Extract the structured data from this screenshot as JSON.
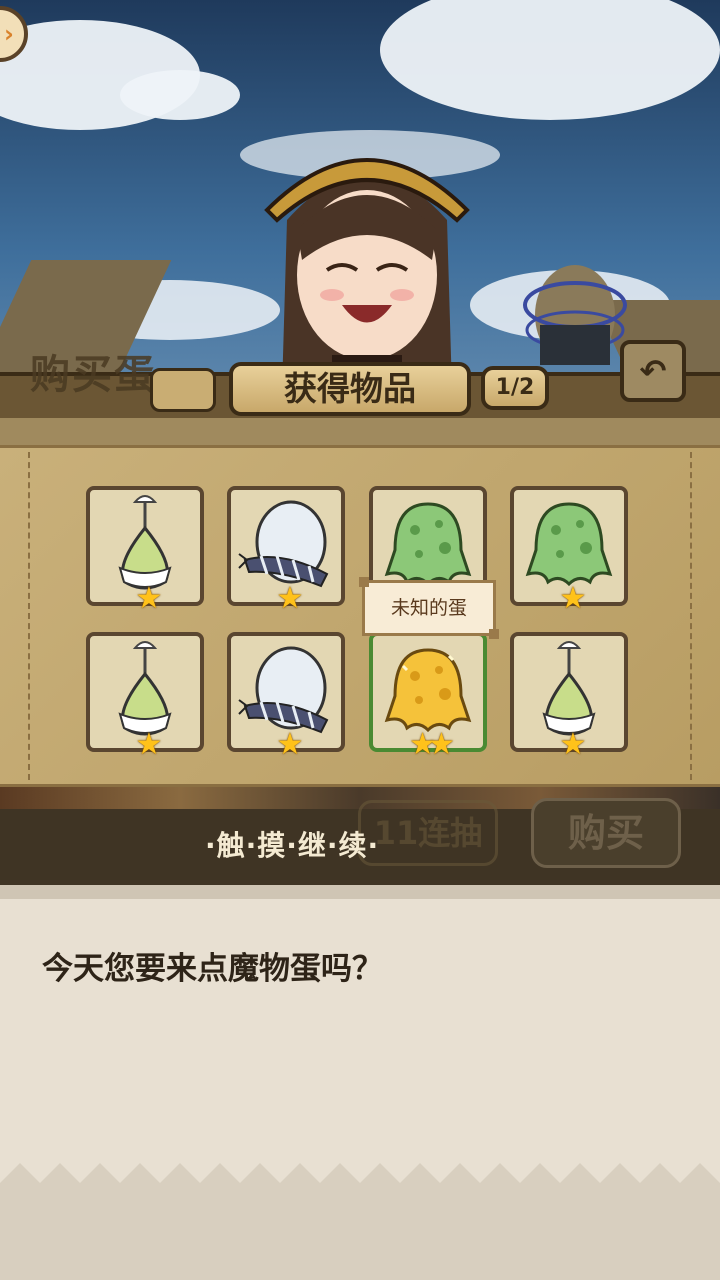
{
  "header": {
    "bg_title": "购买蛋",
    "title": "获得物品",
    "page_indicator": "1/2"
  },
  "grid": {
    "items": [
      {
        "name": "white-sprout-egg",
        "stars": "★"
      },
      {
        "name": "striped-feather-egg",
        "stars": "★"
      },
      {
        "name": "green-slime-egg",
        "stars": "★"
      },
      {
        "name": "green-slime-egg",
        "stars": "★"
      },
      {
        "name": "white-sprout-egg",
        "stars": "★"
      },
      {
        "name": "striped-feather-egg",
        "stars": "★"
      },
      {
        "name": "gold-slime-egg",
        "stars": "★★"
      },
      {
        "name": "white-sprout-egg",
        "stars": "★"
      }
    ],
    "tooltip": "未知的蛋"
  },
  "actions": {
    "ghost_tab": "11连抽",
    "buy_label": "购买",
    "continue_hint": "·触·摸·继·续·"
  },
  "dialog": {
    "text": "今天您要来点魔物蛋吗？"
  },
  "colors": {
    "panel": "#c9b07a",
    "frame": "#3a2b16",
    "star": "#ffc21a",
    "selected_border": "#4a8a32"
  }
}
